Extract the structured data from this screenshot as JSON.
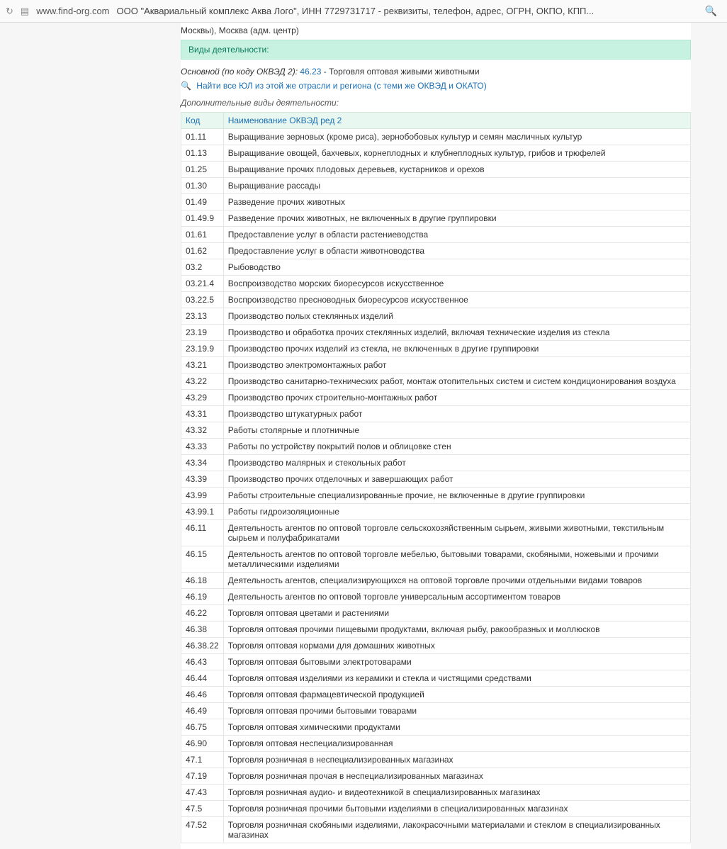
{
  "browser": {
    "url": "www.find-org.com",
    "title": "ООО \"Аквариальный комплекс Аква Лого\", ИНН 7729731717 - реквизиты, телефон, адрес, ОГРН, ОКПО, КПП..."
  },
  "crumb": "Москвы), Москва (адм. центр)",
  "section_title": "Виды деятельности:",
  "main_text_prefix": "Основной (по коду ОКВЭД 2):",
  "main_code": "46.23",
  "main_desc": " - Торговля оптовая живыми животными",
  "find_link": "Найти все ЮЛ из этой же отрасли и региона (с теми же ОКВЭД и ОКАТО)",
  "additional_label": "Дополнительные виды деятельности:",
  "table_headers": {
    "code": "Код",
    "name": "Наименование ОКВЭД ред 2"
  },
  "rows": [
    {
      "code": "01.11",
      "name": "Выращивание зерновых (кроме риса), зернобобовых культур и семян масличных культур"
    },
    {
      "code": "01.13",
      "name": "Выращивание овощей, бахчевых, корнеплодных и клубнеплодных культур, грибов и трюфелей"
    },
    {
      "code": "01.25",
      "name": "Выращивание прочих плодовых деревьев, кустарников и орехов"
    },
    {
      "code": "01.30",
      "name": "Выращивание рассады"
    },
    {
      "code": "01.49",
      "name": "Разведение прочих животных"
    },
    {
      "code": "01.49.9",
      "name": "Разведение прочих животных, не включенных в другие группировки"
    },
    {
      "code": "01.61",
      "name": "Предоставление услуг в области растениеводства"
    },
    {
      "code": "01.62",
      "name": "Предоставление услуг в области животноводства"
    },
    {
      "code": "03.2",
      "name": "Рыбоводство"
    },
    {
      "code": "03.21.4",
      "name": "Воспроизводство морских биоресурсов искусственное"
    },
    {
      "code": "03.22.5",
      "name": "Воспроизводство пресноводных биоресурсов искусственное"
    },
    {
      "code": "23.13",
      "name": "Производство полых стеклянных изделий"
    },
    {
      "code": "23.19",
      "name": "Производство и обработка прочих стеклянных изделий, включая технические изделия из стекла"
    },
    {
      "code": "23.19.9",
      "name": "Производство прочих изделий из стекла, не включенных в другие группировки"
    },
    {
      "code": "43.21",
      "name": "Производство электромонтажных работ"
    },
    {
      "code": "43.22",
      "name": "Производство санитарно-технических работ, монтаж отопительных систем и систем кондиционирования воздуха"
    },
    {
      "code": "43.29",
      "name": "Производство прочих строительно-монтажных работ"
    },
    {
      "code": "43.31",
      "name": "Производство штукатурных работ"
    },
    {
      "code": "43.32",
      "name": "Работы столярные и плотничные"
    },
    {
      "code": "43.33",
      "name": "Работы по устройству покрытий полов и облицовке стен"
    },
    {
      "code": "43.34",
      "name": "Производство малярных и стекольных работ"
    },
    {
      "code": "43.39",
      "name": "Производство прочих отделочных и завершающих работ"
    },
    {
      "code": "43.99",
      "name": "Работы строительные специализированные прочие, не включенные в другие группировки"
    },
    {
      "code": "43.99.1",
      "name": "Работы гидроизоляционные"
    },
    {
      "code": "46.11",
      "name": "Деятельность агентов по оптовой торговле сельскохозяйственным сырьем, живыми животными, текстильным сырьем и полуфабрикатами"
    },
    {
      "code": "46.15",
      "name": "Деятельность агентов по оптовой торговле мебелью, бытовыми товарами, скобяными, ножевыми и прочими металлическими изделиями"
    },
    {
      "code": "46.18",
      "name": "Деятельность агентов, специализирующихся на оптовой торговле прочими отдельными видами товаров"
    },
    {
      "code": "46.19",
      "name": "Деятельность агентов по оптовой торговле универсальным ассортиментом товаров"
    },
    {
      "code": "46.22",
      "name": "Торговля оптовая цветами и растениями"
    },
    {
      "code": "46.38",
      "name": "Торговля оптовая прочими пищевыми продуктами, включая рыбу, ракообразных и моллюсков"
    },
    {
      "code": "46.38.22",
      "name": "Торговля оптовая кормами для домашних животных"
    },
    {
      "code": "46.43",
      "name": "Торговля оптовая бытовыми электротоварами"
    },
    {
      "code": "46.44",
      "name": "Торговля оптовая изделиями из керамики и стекла и чистящими средствами"
    },
    {
      "code": "46.46",
      "name": "Торговля оптовая фармацевтической продукцией"
    },
    {
      "code": "46.49",
      "name": "Торговля оптовая прочими бытовыми товарами"
    },
    {
      "code": "46.75",
      "name": "Торговля оптовая химическими продуктами"
    },
    {
      "code": "46.90",
      "name": "Торговля оптовая неспециализированная"
    },
    {
      "code": "47.1",
      "name": "Торговля розничная в неспециализированных магазинах"
    },
    {
      "code": "47.19",
      "name": "Торговля розничная прочая в неспециализированных магазинах"
    },
    {
      "code": "47.43",
      "name": "Торговля розничная аудио- и видеотехникой в специализированных магазинах"
    },
    {
      "code": "47.5",
      "name": "Торговля розничная прочими бытовыми изделиями в специализированных магазинах"
    },
    {
      "code": "47.52",
      "name": "Торговля розничная скобяными изделиями, лакокрасочными материалами и стеклом в специализированных магазинах"
    }
  ]
}
